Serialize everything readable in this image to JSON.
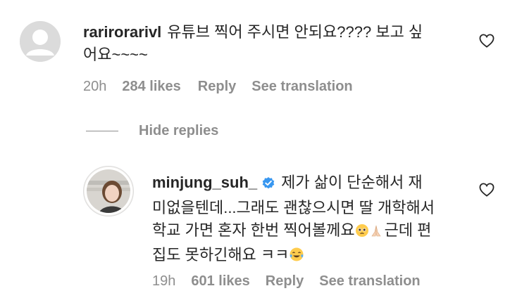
{
  "comment1": {
    "username": "rarirorarivl",
    "line1": "유튜브 찍어 주시면 안되요???? 보고 싶",
    "line2": "어요~~~~",
    "time": "20h",
    "likes": "284 likes",
    "reply_label": "Reply",
    "translate_label": "See translation"
  },
  "hide_replies_label": "Hide replies",
  "reply1": {
    "username": "minjung_suh_",
    "line1": "제가 삶이 단순해서 재",
    "line2": "미없을텐데...그래도 괜찮으시면 딸 개학해서",
    "line3": "학교 가면 혼자 한번 찍어볼께요",
    "line3b": "근데 편",
    "line4": "집도 못하긴해요 ㅋㅋ",
    "time": "19h",
    "likes": "601 likes",
    "reply_label": "Reply",
    "translate_label": "See translation"
  },
  "colors": {
    "text": "#262626",
    "secondary": "#8e8e8e",
    "verified": "#3897f0"
  }
}
